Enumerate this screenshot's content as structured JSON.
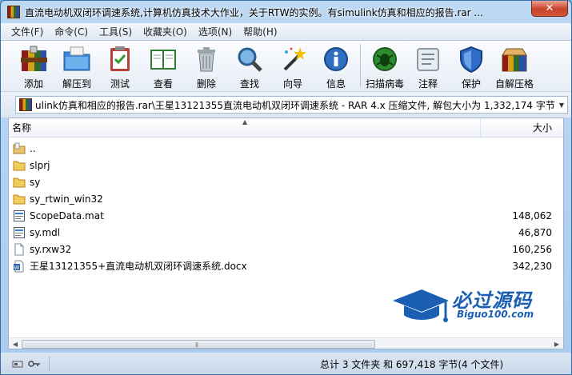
{
  "window": {
    "title": "直流电动机双闭环调速系统,计算机仿真技术大作业，关于RTW的实例。有simulink仿真和相应的报告.rar ...",
    "close_label": "✕"
  },
  "menu": [
    "文件(F)",
    "命令(C)",
    "工具(S)",
    "收藏夹(O)",
    "选项(N)",
    "帮助(H)"
  ],
  "toolbar": [
    {
      "label": "添加",
      "icon": "archive-add-icon"
    },
    {
      "label": "解压到",
      "icon": "extract-folder-icon"
    },
    {
      "label": "测试",
      "icon": "test-clipboard-icon"
    },
    {
      "label": "查看",
      "icon": "view-book-icon"
    },
    {
      "label": "删除",
      "icon": "trash-icon"
    },
    {
      "label": "查找",
      "icon": "magnifier-icon"
    },
    {
      "label": "向导",
      "icon": "wizard-wand-icon"
    },
    {
      "label": "信息",
      "icon": "info-icon"
    },
    {
      "label": "扫描病毒",
      "icon": "virus-scan-icon"
    },
    {
      "label": "注释",
      "icon": "comment-icon"
    },
    {
      "label": "保护",
      "icon": "shield-icon"
    },
    {
      "label": "自解压格",
      "icon": "sfx-box-icon"
    }
  ],
  "address": {
    "path": "ulink仿真和相应的报告.rar\\王星13121355直流电动机双闭环调速系统 - RAR 4.x 压缩文件, 解包大小为 1,332,174 字节"
  },
  "columns": {
    "name": "名称",
    "size": "大小"
  },
  "files": [
    {
      "name": "..",
      "size": "",
      "type": "up"
    },
    {
      "name": "slprj",
      "size": "",
      "type": "folder"
    },
    {
      "name": "sy",
      "size": "",
      "type": "folder"
    },
    {
      "name": "sy_rtwin_win32",
      "size": "",
      "type": "folder"
    },
    {
      "name": "ScopeData.mat",
      "size": "148,062",
      "type": "mat"
    },
    {
      "name": "sy.mdl",
      "size": "46,870",
      "type": "mdl"
    },
    {
      "name": "sy.rxw32",
      "size": "160,256",
      "type": "file"
    },
    {
      "name": "王星13121355+直流电动机双闭环调速系统.docx",
      "size": "342,230",
      "type": "docx"
    }
  ],
  "status": {
    "text": "总计 3 文件夹 和 697,418 字节(4 个文件)"
  },
  "watermark": {
    "main": "必过源码",
    "sub": "Biguo100.com"
  },
  "colors": {
    "accent": "#1b5fb3",
    "folder": "#e8b73a",
    "close": "#c7432a"
  }
}
